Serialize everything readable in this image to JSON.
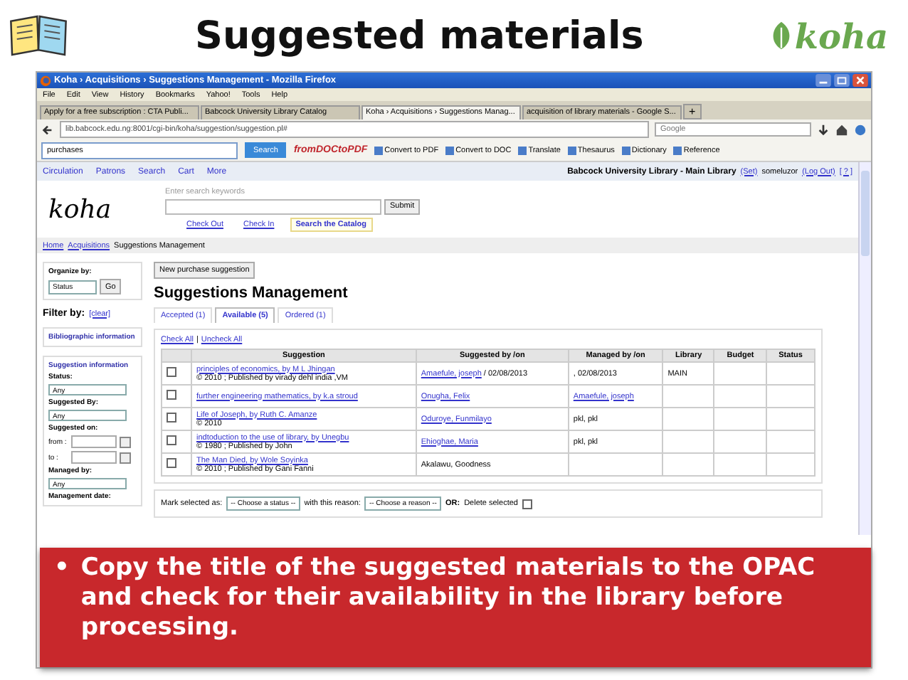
{
  "slide": {
    "title": "Suggested materials",
    "logo": "koha"
  },
  "browser": {
    "window_title": "Koha › Acquisitions › Suggestions Management - Mozilla Firefox",
    "menu": [
      "File",
      "Edit",
      "View",
      "History",
      "Bookmarks",
      "Yahoo!",
      "Tools",
      "Help"
    ],
    "tabs": [
      {
        "label": "Apply for a free subscription : CTA Publi...",
        "selected": false
      },
      {
        "label": "Babcock University Library Catalog",
        "selected": false
      },
      {
        "label": "Koha › Acquisitions › Suggestions Manag...",
        "selected": true
      },
      {
        "label": "acquisition of library materials - Google S...",
        "selected": false
      }
    ],
    "new_tab": "+",
    "url": "lib.babcock.edu.ng:8001/cgi-bin/koha/suggestion/suggestion.pl#",
    "web_search_placeholder": "Google",
    "toolbar_search": "purchases",
    "toolbar_search_button": "Search",
    "addon_logo": "fromDOCtoPDF",
    "toolbar_items": [
      "Convert to PDF",
      "Convert to DOC",
      "Translate",
      "Thesaurus",
      "Dictionary",
      "Reference"
    ]
  },
  "koha": {
    "nav": [
      "Circulation",
      "Patrons",
      "Search",
      "Cart",
      "More"
    ],
    "library": "Babcock University Library - Main Library",
    "set": "(Set)",
    "user": "someluzor",
    "logout": "(Log Out)",
    "help": "[ ? ]",
    "logo": "koha",
    "search_label": "Enter search keywords",
    "submit": "Submit",
    "links": [
      {
        "label": "Check Out",
        "selected": false
      },
      {
        "label": "Check In",
        "selected": false
      },
      {
        "label": "Search the Catalog",
        "selected": true
      }
    ],
    "breadcrumb": [
      "Home",
      "Acquisitions",
      "Suggestions Management"
    ],
    "sidebar": {
      "organize_label": "Organize by:",
      "organize_value": "Status",
      "go": "Go",
      "filter_label": "Filter by:",
      "clear": "[clear]",
      "biblio_heading": "Bibliographic information",
      "suggestion_heading": "Suggestion information",
      "fields": [
        {
          "kind": "select",
          "label": "Status:",
          "value": "Any"
        },
        {
          "kind": "select",
          "label": "Suggested By:",
          "value": "Any"
        },
        {
          "kind": "heading",
          "label": "Suggested on:"
        },
        {
          "kind": "date",
          "label": "from :"
        },
        {
          "kind": "date",
          "label": "to :"
        },
        {
          "kind": "select",
          "label": "Managed by:",
          "value": "Any"
        },
        {
          "kind": "heading",
          "label": "Management date:"
        }
      ]
    },
    "new_button": "New purchase suggestion",
    "heading": "Suggestions Management",
    "tabs": [
      {
        "label": "Accepted (1)",
        "selected": false
      },
      {
        "label": "Available (5)",
        "selected": true
      },
      {
        "label": "Ordered (1)",
        "selected": false
      }
    ],
    "check_all": "Check All",
    "check_separator": "|",
    "uncheck_all": "Uncheck All",
    "columns": [
      "Suggestion",
      "Suggested by /on",
      "Managed by /on",
      "Library",
      "Budget",
      "Status"
    ],
    "rows": [
      {
        "checked": false,
        "title": "principles of economics, by M L Jhingan",
        "details": "© 2010 ; Published by virady dehl india ,VM",
        "suggested_by": "Amaefule, joseph",
        "suggested_by_link": true,
        "suggested_on": " / 02/08/2013",
        "managed_by": "",
        "managed_on": ", 02/08/2013",
        "library": "MAIN"
      },
      {
        "checked": false,
        "title": "further engineering mathematics, by k.a stroud",
        "details": "",
        "suggested_by": "Onugha, Felix",
        "suggested_by_link": true,
        "suggested_on": "",
        "managed_by": "Amaefule, joseph",
        "managed_on": "",
        "library": ""
      },
      {
        "checked": false,
        "title": "Life of Joseph, by Ruth C. Amanze",
        "details": "© 2010",
        "suggested_by": "Oduroye, Funmilayo",
        "suggested_by_link": true,
        "suggested_on": "",
        "managed_by": "",
        "managed_on": "pkl, pkl",
        "library": ""
      },
      {
        "checked": false,
        "title": "indtoduction to the use of library, by Unegbu",
        "details": "© 1980 ; Published by John",
        "suggested_by": "Ehioghae, Maria",
        "suggested_by_link": true,
        "suggested_on": "",
        "managed_by": "",
        "managed_on": "pkl, pkl",
        "library": ""
      },
      {
        "checked": false,
        "title": "The Man Died, by Wole Soyinka",
        "details": "© 2010 ; Published by Gani Fanni",
        "suggested_by": "Akalawu, Goodness",
        "suggested_by_link": false,
        "suggested_on": "",
        "managed_by": "",
        "managed_on": "",
        "library": ""
      }
    ],
    "mark_label": "Mark selected as:",
    "status_select": "-- Choose a status --",
    "reason_label": "with this reason:",
    "reason_select": "-- Choose a reason --",
    "or": "OR:",
    "delete_label": "Delete selected",
    "delete_checked": false
  },
  "callout": {
    "bullet": "•",
    "text": "Copy the title of the suggested materials to the OPAC and check for their availability in the library before processing."
  }
}
